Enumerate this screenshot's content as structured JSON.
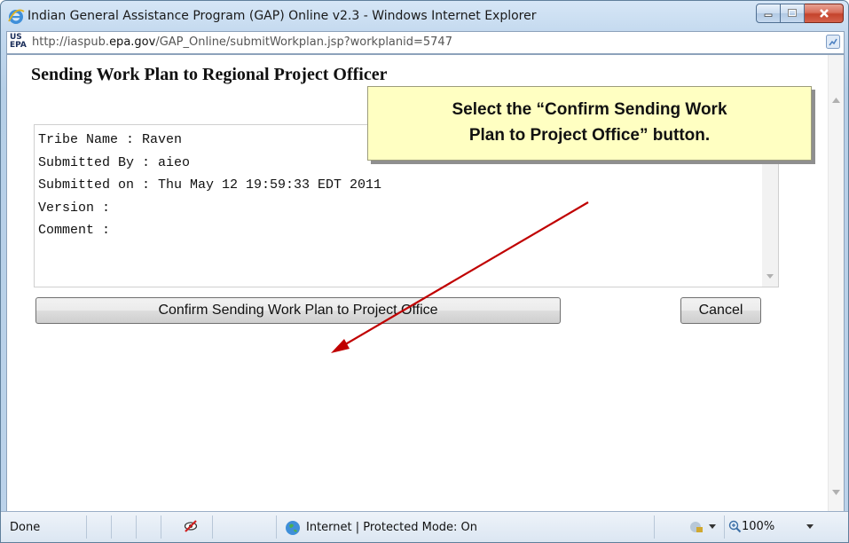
{
  "window": {
    "title": "Indian General Assistance Program (GAP) Online v2.3 - Windows Internet Explorer"
  },
  "address_bar": {
    "logo_text": "US EPA",
    "url_prefix": "http://iaspub.",
    "url_domain": "epa.gov",
    "url_path": "/GAP_Online/submitWorkplan.jsp?workplanid=5747"
  },
  "page": {
    "title": "Sending Work Plan to Regional Project Officer",
    "details_lines": [
      "Tribe Name : Raven",
      "Submitted By : aieo",
      "Submitted on : Thu May 12 19:59:33 EDT 2011",
      "Version :",
      "Comment :"
    ],
    "confirm_button": "Confirm Sending Work Plan to Project Office",
    "cancel_button": "Cancel"
  },
  "callout": {
    "line1": "Select the “Confirm Sending Work",
    "line2": "Plan to Project Office” button."
  },
  "status_bar": {
    "status": "Done",
    "zone": "Internet | Protected Mode: On",
    "zoom": "100%"
  },
  "colors": {
    "arrow": "#c00000",
    "callout_bg": "#ffffc2"
  }
}
